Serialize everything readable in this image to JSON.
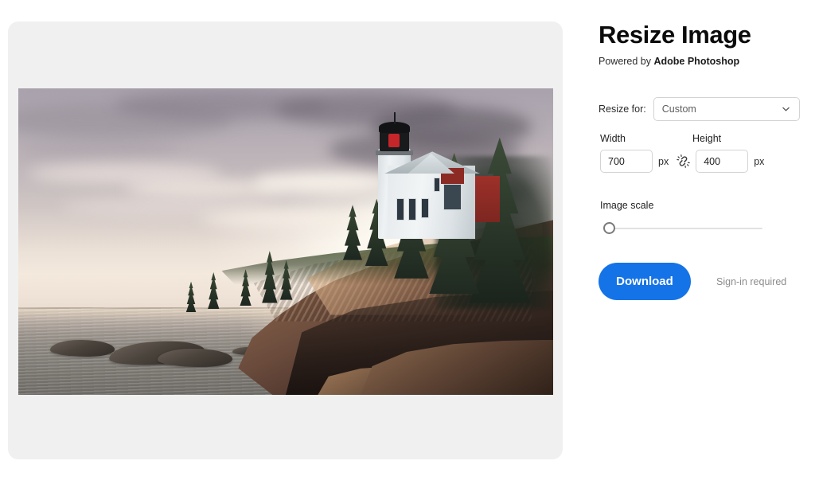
{
  "app": {
    "title": "Resize Image",
    "powered_by_prefix": "Powered by ",
    "powered_by_brand": "Adobe Photoshop"
  },
  "preview": {
    "panel_background": "#f0f0f0",
    "image_alt": "Bass Harbor Head Lighthouse on a rocky coastal cliff at sunset with clouds and calm sea"
  },
  "resize_for": {
    "label": "Resize for:",
    "selected": "Custom",
    "options": [
      "Custom"
    ],
    "chevron_icon": "chevron-down-icon"
  },
  "dimensions": {
    "width_label": "Width",
    "height_label": "Height",
    "width_value": "700",
    "height_value": "400",
    "width_unit": "px",
    "height_unit": "px",
    "link_icon": "broken-chain-unlink-icon",
    "link_state": "unlinked"
  },
  "image_scale": {
    "label": "Image scale",
    "value": 0,
    "min": 0,
    "max": 100
  },
  "actions": {
    "download_label": "Download",
    "signin_note": "Sign-in required",
    "accent_color": "#1473e6"
  }
}
